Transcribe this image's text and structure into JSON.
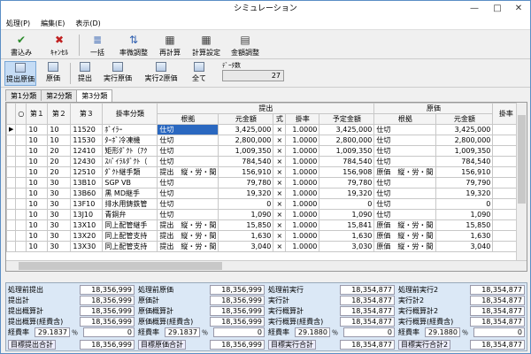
{
  "window": {
    "title": "シミュレーション",
    "minimize": "—",
    "maximize": "□",
    "close": "✕"
  },
  "menu": [
    "処理(P)",
    "編集(E)",
    "表示(D)"
  ],
  "toolbar": {
    "save": "書込み",
    "cancel": "ｷｬﾝｾﾙ",
    "bulk": "一括",
    "rate_adjust": "率微調整",
    "recalc": "再計算",
    "calc_settings": "計算設定",
    "amount_adjust": "金額調整"
  },
  "toolbar2": {
    "extract_cost": "提出原価",
    "cost": "原価",
    "submit": "提出",
    "exec_cost": "実行原価",
    "exec2_cost": "実行2原価",
    "all": "全て"
  },
  "data_count": {
    "label": "ﾃﾞｰﾀ数",
    "value": "27"
  },
  "tabs": [
    "第1分類",
    "第2分類",
    "第3分類"
  ],
  "grid": {
    "headers": {
      "g_teishutsu": "提出",
      "g_genka": "原価",
      "col1": "第１",
      "col2": "第２",
      "col3": "第３",
      "koumoku": "掛率分類",
      "konkyo": "根拠",
      "motokin": "元金額",
      "shiki": "式",
      "kakeritsu": "掛率",
      "yotei": "予定金額",
      "konkyo2": "根拠",
      "motokin2": "元金額",
      "next": "掛率"
    },
    "rows": [
      [
        "10",
        "10",
        "11520",
        "ﾎﾞｲﾗｰ",
        "仕切",
        "3,425,000",
        "×",
        "1.0000",
        "3,425,000",
        "仕切",
        "3,425,000"
      ],
      [
        "10",
        "10",
        "11530",
        "ﾀｰﾎﾞ冷凍機",
        "仕切",
        "2,800,000",
        "×",
        "1.0000",
        "2,800,000",
        "仕切",
        "2,800,000"
      ],
      [
        "10",
        "20",
        "12410",
        "矩形ﾀﾞｸﾄ（ｱｸ",
        "仕切",
        "1,009,350",
        "×",
        "1.0000",
        "1,009,350",
        "仕切",
        "1,009,350"
      ],
      [
        "10",
        "20",
        "12430",
        "ｽﾊﾟｲﾗﾙﾀﾞｸﾄ（",
        "仕切",
        "784,540",
        "×",
        "1.0000",
        "784,540",
        "仕切",
        "784,540"
      ],
      [
        "10",
        "20",
        "12510",
        "ﾀﾞｸﾄ継手類",
        "提出　縦・労・間",
        "156,910",
        "×",
        "1.0000",
        "156,908",
        "原価　縦・労・間",
        "156,910"
      ],
      [
        "10",
        "30",
        "13B10",
        "SGP VB",
        "仕切",
        "79,780",
        "×",
        "1.0000",
        "79,780",
        "仕切",
        "79,790"
      ],
      [
        "10",
        "30",
        "13B60",
        "黒 MD継手",
        "仕切",
        "19,320",
        "×",
        "1.0000",
        "19,320",
        "仕切",
        "19,320"
      ],
      [
        "10",
        "30",
        "13F10",
        "排水用鋳鉄管",
        "仕切",
        "0",
        "×",
        "1.0000",
        "0",
        "仕切",
        "0"
      ],
      [
        "10",
        "30",
        "13J10",
        "青銅弁",
        "仕切",
        "1,090",
        "×",
        "1.0000",
        "1,090",
        "仕切",
        "1,090"
      ],
      [
        "10",
        "30",
        "13X10",
        "同上配管継手",
        "提出　縦・労・間",
        "15,850",
        "×",
        "1.0000",
        "15,841",
        "原価　縦・労・間",
        "15,850"
      ],
      [
        "10",
        "30",
        "13X20",
        "同上配管支持",
        "提出　縦・労・間",
        "1,630",
        "×",
        "1.0000",
        "1,630",
        "原価　縦・労・間",
        "1,630"
      ],
      [
        "10",
        "30",
        "13X30",
        "同上配管支持",
        "提出　縦・労・間",
        "3,040",
        "×",
        "1.0000",
        "3,030",
        "原価　縦・労・間",
        "3,040"
      ]
    ]
  },
  "summary": {
    "col1": {
      "r1": [
        "処理前提出",
        "18,356,999"
      ],
      "r2": [
        "提出計",
        "18,356,999"
      ],
      "r3": [
        "提出概算計",
        "18,356,999"
      ],
      "r4": [
        "提出概算(経費含)",
        "18,356,999"
      ],
      "rate": [
        "経費率",
        "29.1837",
        "％",
        "0"
      ],
      "target": [
        "目標提出合計",
        "18,356,999"
      ]
    },
    "col2": {
      "r1": [
        "処理前原価",
        "18,356,999"
      ],
      "r2": [
        "原価計",
        "18,356,999"
      ],
      "r3": [
        "原価概算計",
        "18,356,999"
      ],
      "r4": [
        "原価概算(経費含)",
        "18,356,999"
      ],
      "rate": [
        "経費率",
        "29.1837",
        "％",
        "0"
      ],
      "target": [
        "目標原価合計",
        "18,356,999"
      ]
    },
    "col3": {
      "r1": [
        "処理前実行",
        "18,354,877"
      ],
      "r2": [
        "実行計",
        "18,354,877"
      ],
      "r3": [
        "実行概算計",
        "18,354,877"
      ],
      "r4": [
        "実行概算(経費含)",
        "18,354,877"
      ],
      "rate": [
        "経費率",
        "29.1880",
        "％",
        "0"
      ],
      "target": [
        "目標実行合計",
        "18,354,877"
      ]
    },
    "col4": {
      "r1": [
        "処理前実行2",
        "18,354,877"
      ],
      "r2": [
        "実行計2",
        "18,354,877"
      ],
      "r3": [
        "実行概算計2",
        "18,354,877"
      ],
      "r4": [
        "実行概算(経費含)",
        "18,354,877"
      ],
      "rate": [
        "経費率",
        "29.1880",
        "％",
        "0"
      ],
      "target": [
        "目標実行合計2",
        "18,354,877"
      ]
    }
  }
}
